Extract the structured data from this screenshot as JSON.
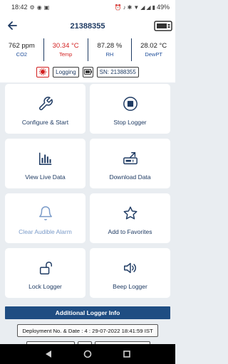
{
  "status_bar": {
    "time": "18:42",
    "battery": "49%"
  },
  "header": {
    "title": "21388355"
  },
  "readings": [
    {
      "value": "762 ppm",
      "label": "CO2",
      "alert": false
    },
    {
      "value": "30.34 °C",
      "label": "Temp",
      "alert": true
    },
    {
      "value": "87.28 %",
      "label": "RH",
      "alert": false
    },
    {
      "value": "28.02 °C",
      "label": "DewPT",
      "alert": false
    }
  ],
  "chips": {
    "status": "Logging",
    "serial": "SN: 21388355"
  },
  "actions": [
    {
      "label": "Configure & Start",
      "icon": "wrench-icon",
      "enabled": true
    },
    {
      "label": "Stop Logger",
      "icon": "stop-icon",
      "enabled": true
    },
    {
      "label": "View Live Data",
      "icon": "bar-chart-icon",
      "enabled": true
    },
    {
      "label": "Download Data",
      "icon": "download-icon",
      "enabled": true
    },
    {
      "label": "Clear Audible Alarm",
      "icon": "bell-icon",
      "enabled": false
    },
    {
      "label": "Add to Favorites",
      "icon": "star-icon",
      "enabled": true
    },
    {
      "label": "Lock Logger",
      "icon": "unlock-icon",
      "enabled": true
    },
    {
      "label": "Beep Logger",
      "icon": "speaker-icon",
      "enabled": true
    }
  ],
  "info": {
    "header": "Additional Logger Info",
    "deployment": "Deployment No. & Date : 4 : 29-07-2022 18:41:59 IST"
  },
  "colors": {
    "primary": "#1f4d82",
    "alert": "#d21f1f",
    "background": "#e9edf1",
    "disabled": "#7a9bc9"
  }
}
